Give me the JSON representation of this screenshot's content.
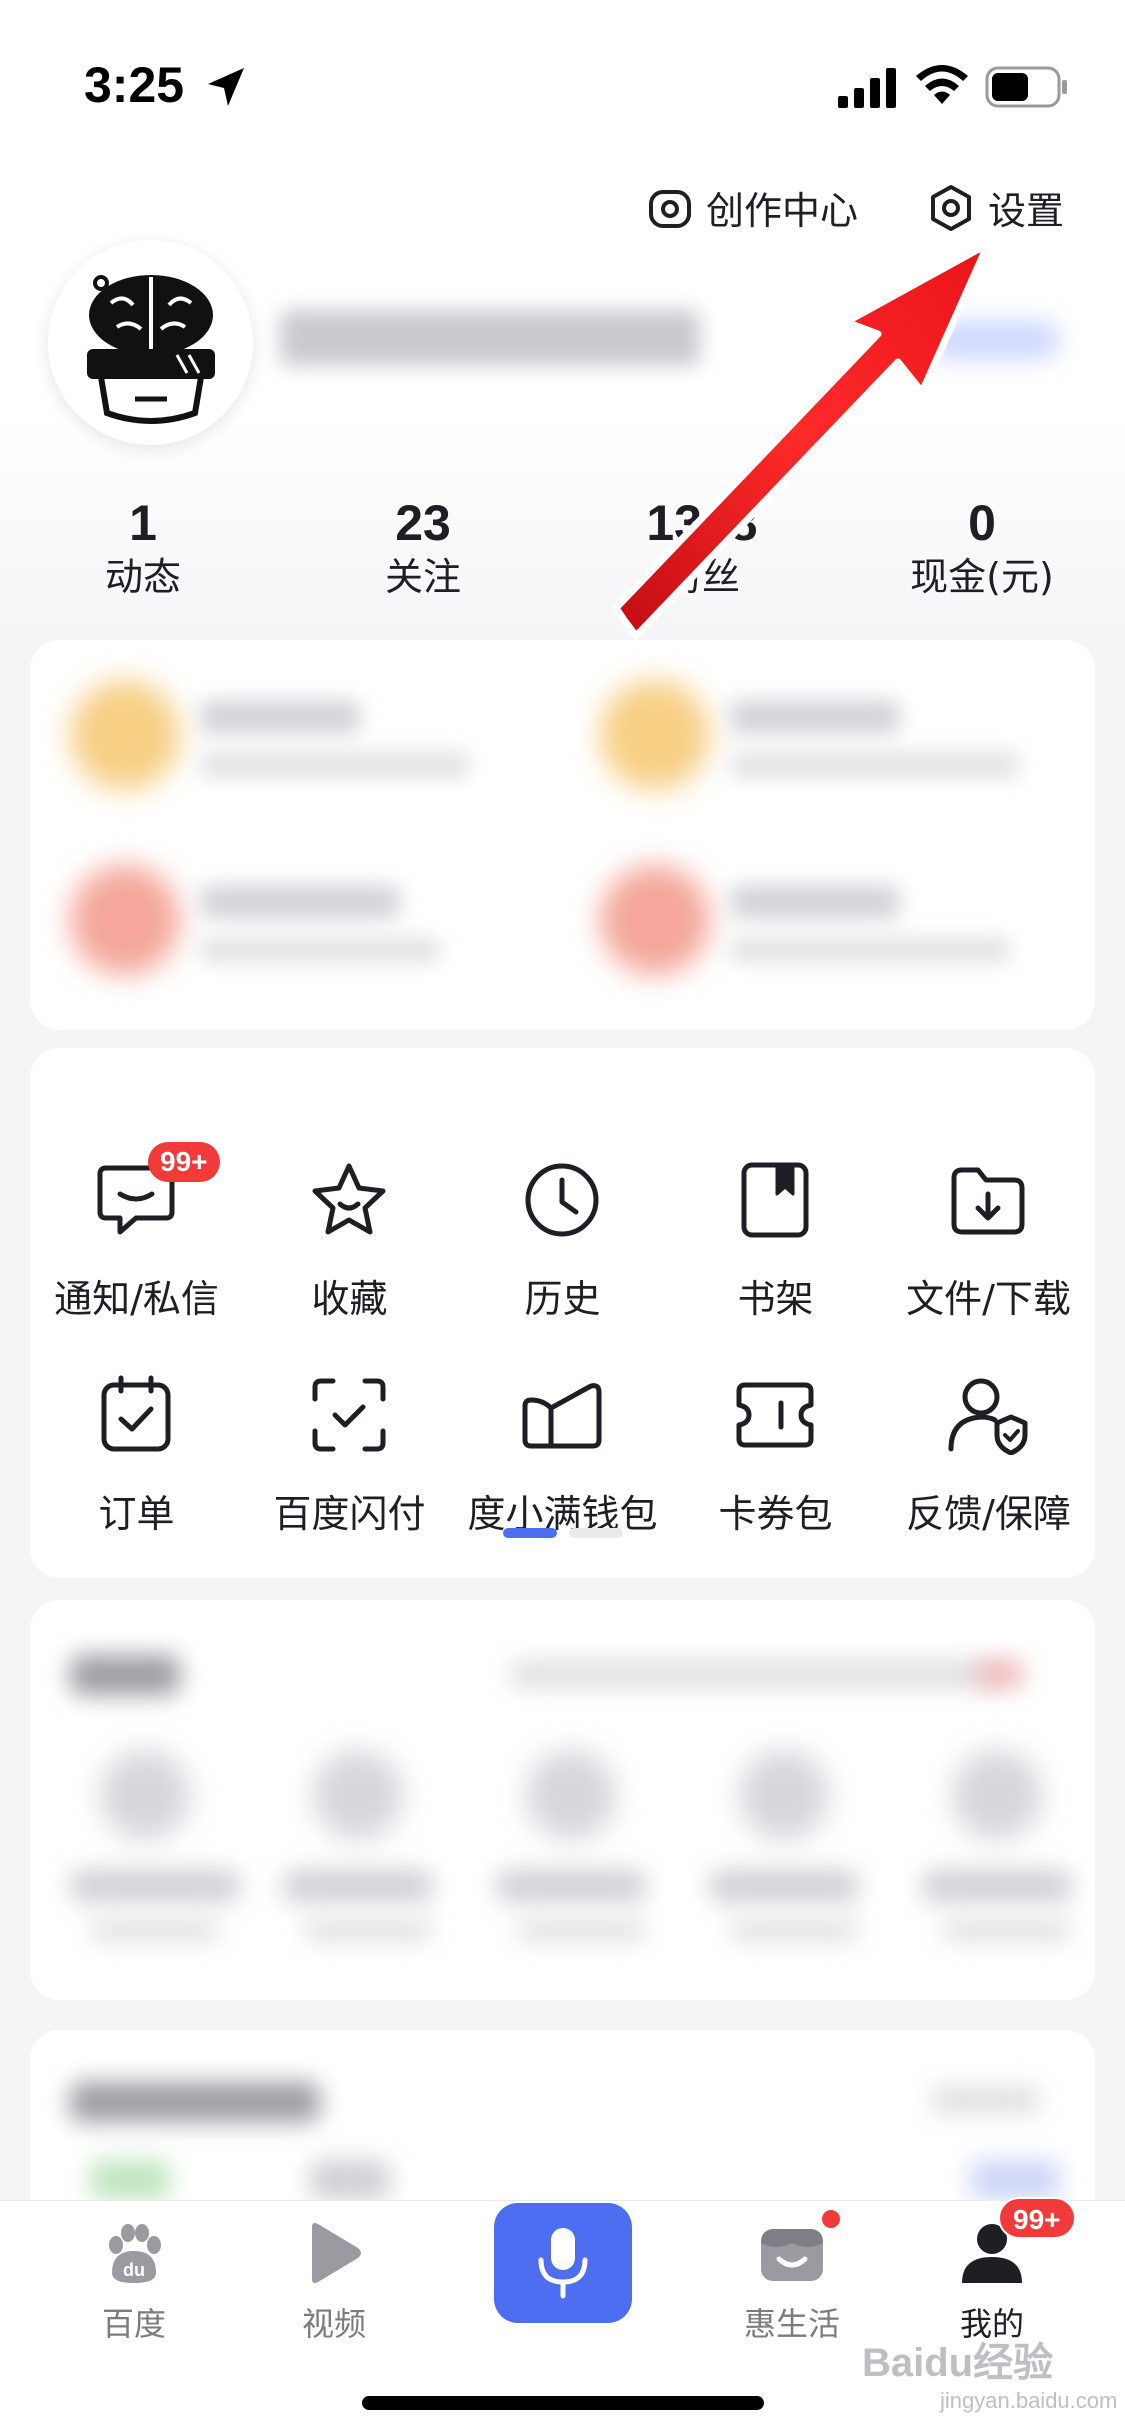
{
  "status_bar": {
    "time": "3:25",
    "icons": [
      "location-arrow-icon",
      "signal-icon",
      "wifi-icon",
      "battery-icon"
    ]
  },
  "header": {
    "creator_center": "创作中心",
    "settings": "设置"
  },
  "stats": [
    {
      "value": "1",
      "label": "动态"
    },
    {
      "value": "23",
      "label": "关注"
    },
    {
      "value": "1308",
      "label": "粉丝"
    },
    {
      "value": "0",
      "label": "现金(元)"
    }
  ],
  "grid": {
    "items": [
      {
        "label": "通知/私信",
        "icon": "message-icon",
        "badge": "99+"
      },
      {
        "label": "收藏",
        "icon": "star-icon"
      },
      {
        "label": "历史",
        "icon": "clock-icon"
      },
      {
        "label": "书架",
        "icon": "bookshelf-icon"
      },
      {
        "label": "文件/下载",
        "icon": "folder-download-icon"
      },
      {
        "label": "订单",
        "icon": "order-icon"
      },
      {
        "label": "百度闪付",
        "icon": "scan-pay-icon"
      },
      {
        "label": "度小满钱包",
        "icon": "wallet-icon"
      },
      {
        "label": "卡券包",
        "icon": "ticket-icon"
      },
      {
        "label": "反馈/保障",
        "icon": "feedback-shield-icon"
      }
    ],
    "pager_pages": 2,
    "pager_active": 1
  },
  "bottom_nav": {
    "items": [
      {
        "label": "百度",
        "icon": "baidu-paw-icon"
      },
      {
        "label": "视频",
        "icon": "video-play-icon"
      },
      {
        "label": "",
        "icon": "microphone-icon"
      },
      {
        "label": "惠生活",
        "icon": "life-service-icon"
      },
      {
        "label": "我的",
        "icon": "profile-icon"
      }
    ],
    "mine_badge": "99+",
    "active": "我的"
  },
  "colors": {
    "accent": "#4e6ef2",
    "badge": "#f33a3a",
    "annotation_arrow": "#e8141a"
  },
  "watermark": {
    "text": "Baidu经验",
    "sub": "jingyan.baidu.com"
  }
}
